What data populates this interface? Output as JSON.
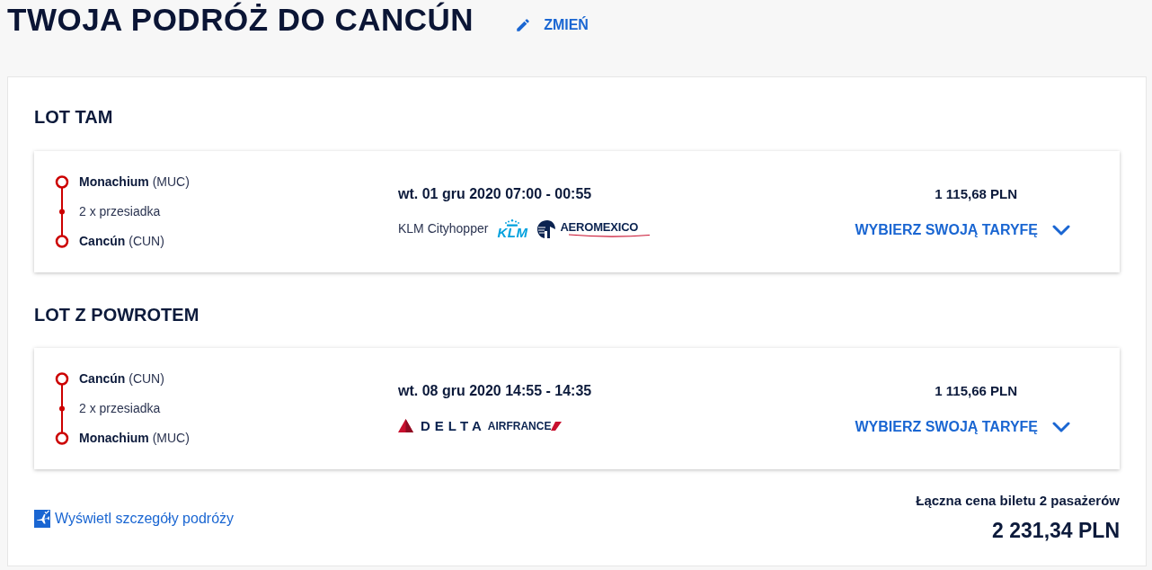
{
  "header": {
    "title": "TWOJA PODRÓŻ DO CANCÚN",
    "edit_link": "ZMIEŃ"
  },
  "flights": [
    {
      "heading": "LOT TAM",
      "stops": [
        {
          "kind": "airport",
          "city": "Monachium",
          "code": "(MUC)"
        },
        {
          "kind": "stopover",
          "text": "2 x przesiadka"
        },
        {
          "kind": "airport",
          "city": "Cancún",
          "code": "(CUN)"
        }
      ],
      "date_time": "wt. 01 gru 2020 07:00 - 00:55",
      "carriers": [
        {
          "kind": "name",
          "text": "KLM Cityhopper"
        },
        {
          "kind": "klm",
          "text": "KLM"
        },
        {
          "kind": "aeromexico",
          "text": "AEROMEXICO"
        }
      ],
      "price": "1 115,68 PLN",
      "fare_link": {
        "label": "WYBIERZ SWOJĄ TARYFĘ",
        "expanded": false
      }
    },
    {
      "heading": "LOT Z POWROTEM",
      "stops": [
        {
          "kind": "airport",
          "city": "Cancún",
          "code": "(CUN)"
        },
        {
          "kind": "stopover",
          "text": "2 x przesiadka"
        },
        {
          "kind": "airport",
          "city": "Monachium",
          "code": "(MUC)"
        }
      ],
      "date_time": "wt. 08 gru 2020 14:55 - 14:35",
      "carriers": [
        {
          "kind": "delta",
          "text": "DELTA"
        },
        {
          "kind": "airfrance",
          "text": "AIRFRANCE"
        }
      ],
      "price": "1 115,66 PLN",
      "fare_link": {
        "label": "WYBIERZ SWOJĄ TARYFĘ",
        "expanded": false
      }
    }
  ],
  "footer": {
    "details_link": "Wyświetl szczegóły podróży",
    "total_label": "Łączna cena biletu 2 pasażerów",
    "total_price": "2 231,34 PLN"
  }
}
